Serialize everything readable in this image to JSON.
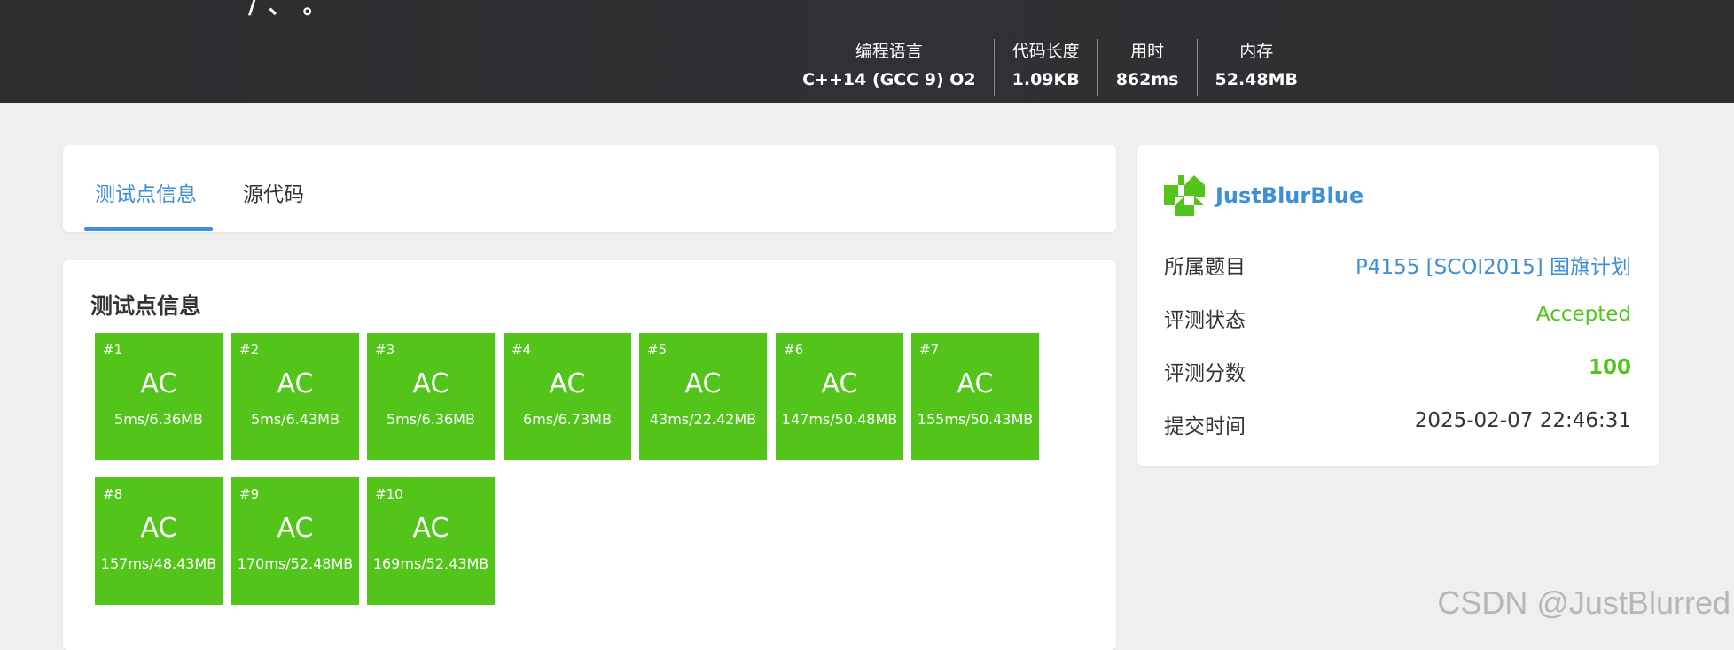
{
  "header": {
    "title_fragment": "/ 、 。",
    "stats": [
      {
        "label": "编程语言",
        "value": "C++14 (GCC 9) O2"
      },
      {
        "label": "代码长度",
        "value": "1.09KB"
      },
      {
        "label": "用时",
        "value": "862ms"
      },
      {
        "label": "内存",
        "value": "52.48MB"
      }
    ]
  },
  "tabs": [
    {
      "label": "测试点信息",
      "active": true
    },
    {
      "label": "源代码",
      "active": false
    }
  ],
  "tests": {
    "title": "测试点信息",
    "color": "#52c41a",
    "cases": [
      {
        "num": "#1",
        "result": "AC",
        "info": "5ms/6.36MB"
      },
      {
        "num": "#2",
        "result": "AC",
        "info": "5ms/6.43MB"
      },
      {
        "num": "#3",
        "result": "AC",
        "info": "5ms/6.36MB"
      },
      {
        "num": "#4",
        "result": "AC",
        "info": "6ms/6.73MB"
      },
      {
        "num": "#5",
        "result": "AC",
        "info": "43ms/22.42MB"
      },
      {
        "num": "#6",
        "result": "AC",
        "info": "147ms/50.48MB"
      },
      {
        "num": "#7",
        "result": "AC",
        "info": "155ms/50.43MB"
      },
      {
        "num": "#8",
        "result": "AC",
        "info": "157ms/48.43MB"
      },
      {
        "num": "#9",
        "result": "AC",
        "info": "170ms/52.48MB"
      },
      {
        "num": "#10",
        "result": "AC",
        "info": "169ms/52.43MB"
      }
    ]
  },
  "sidebar": {
    "user": {
      "name": "JustBlurBlue",
      "avatar_icon": "identicon-icon"
    },
    "rows": [
      {
        "label": "所属题目",
        "value": "P4155 [SCOI2015] 国旗计划",
        "color": "#3d8fd6",
        "bold": false
      },
      {
        "label": "评测状态",
        "value": "Accepted",
        "color": "#52c41a",
        "bold": false
      },
      {
        "label": "评测分数",
        "value": "100",
        "color": "#52c41a",
        "bold": true
      },
      {
        "label": "提交时间",
        "value": "2025-02-07 22:46:31",
        "color": "#333333",
        "bold": false
      }
    ]
  },
  "watermark": "CSDN @JustBlurred"
}
